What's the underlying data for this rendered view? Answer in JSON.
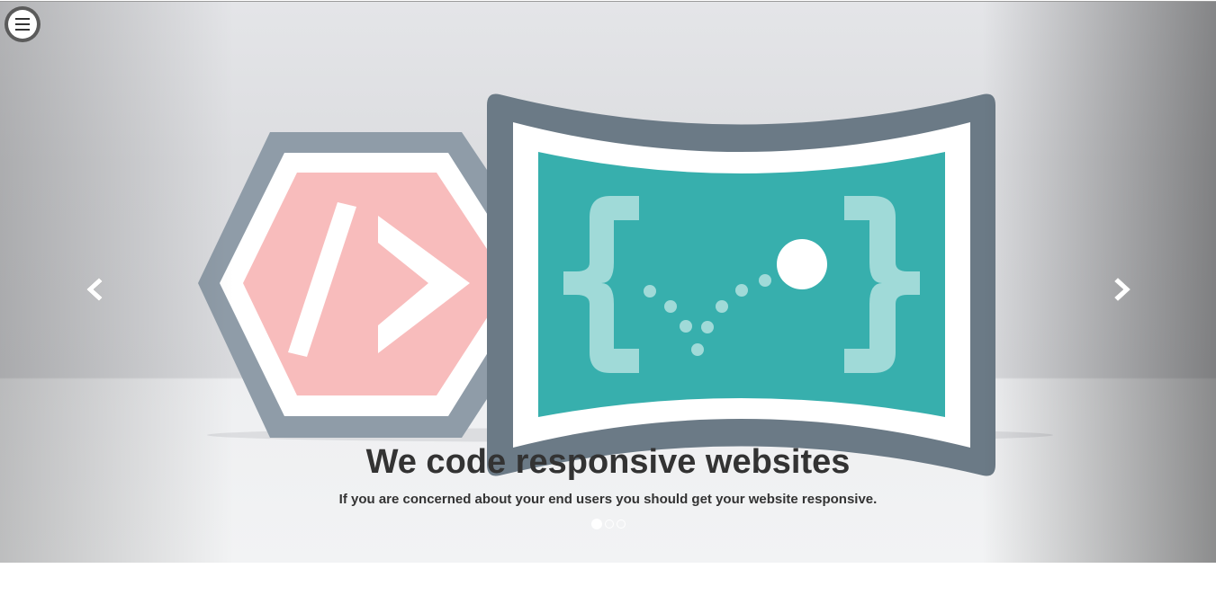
{
  "menu": {
    "icon": "hamburger-menu-icon"
  },
  "carousel": {
    "prev_icon": "chevron-left-icon",
    "next_icon": "chevron-right-icon",
    "slide": {
      "title": "We code responsive websites",
      "subtitle": "If you are concerned about your end users you should get your website responsive."
    },
    "indicators": {
      "count": 3,
      "active": 0
    }
  },
  "colors": {
    "hex_frame": "#8f9ca8",
    "hex_fill": "#f8bcbc",
    "screen_frame": "#6b7a86",
    "screen_fill": "#37afad",
    "brace": "#a0dad8",
    "caption_text": "#333333"
  }
}
